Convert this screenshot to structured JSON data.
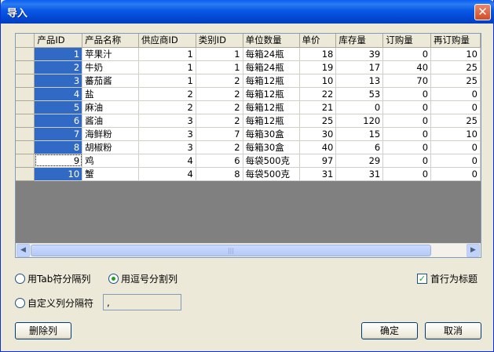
{
  "window": {
    "title": "导入",
    "close_glyph": "✕"
  },
  "grid": {
    "columns": [
      "产品ID",
      "产品名称",
      "供应商ID",
      "类别ID",
      "单位数量",
      "单价",
      "库存量",
      "订购量",
      "再订购量"
    ],
    "rows": [
      [
        "1",
        "苹果汁",
        "1",
        "1",
        "每箱24瓶",
        "18",
        "39",
        "0",
        "10"
      ],
      [
        "2",
        "牛奶",
        "1",
        "1",
        "每箱24瓶",
        "19",
        "17",
        "40",
        "25"
      ],
      [
        "3",
        "蕃茄酱",
        "1",
        "2",
        "每箱12瓶",
        "10",
        "13",
        "70",
        "25"
      ],
      [
        "4",
        "盐",
        "2",
        "2",
        "每箱12瓶",
        "22",
        "53",
        "0",
        "0"
      ],
      [
        "5",
        "麻油",
        "2",
        "2",
        "每箱12瓶",
        "21",
        "0",
        "0",
        "0"
      ],
      [
        "6",
        "酱油",
        "3",
        "2",
        "每箱12瓶",
        "25",
        "120",
        "0",
        "25"
      ],
      [
        "7",
        "海鲜粉",
        "3",
        "7",
        "每箱30盒",
        "30",
        "15",
        "0",
        "10"
      ],
      [
        "8",
        "胡椒粉",
        "3",
        "2",
        "每箱30盒",
        "40",
        "6",
        "0",
        "0"
      ],
      [
        "9",
        "鸡",
        "4",
        "6",
        "每袋500克",
        "97",
        "29",
        "0",
        "0"
      ],
      [
        "10",
        "蟹",
        "4",
        "8",
        "每袋500克",
        "31",
        "31",
        "0",
        "0"
      ]
    ]
  },
  "scrollbar": {
    "left_arrow": "◀",
    "right_arrow": "▶",
    "grip": "|||"
  },
  "options": {
    "tab_separator_label": "用Tab符分隔列",
    "comma_separator_label": "用逗号分割列",
    "custom_separator_label": "自定义列分隔符",
    "custom_separator_value": ",",
    "first_row_header_label": "首行为标题",
    "selected": "comma",
    "first_row_header_checked": true,
    "check_glyph": "✓"
  },
  "buttons": {
    "delete_column": "删除列",
    "ok": "确定",
    "cancel": "取消"
  }
}
